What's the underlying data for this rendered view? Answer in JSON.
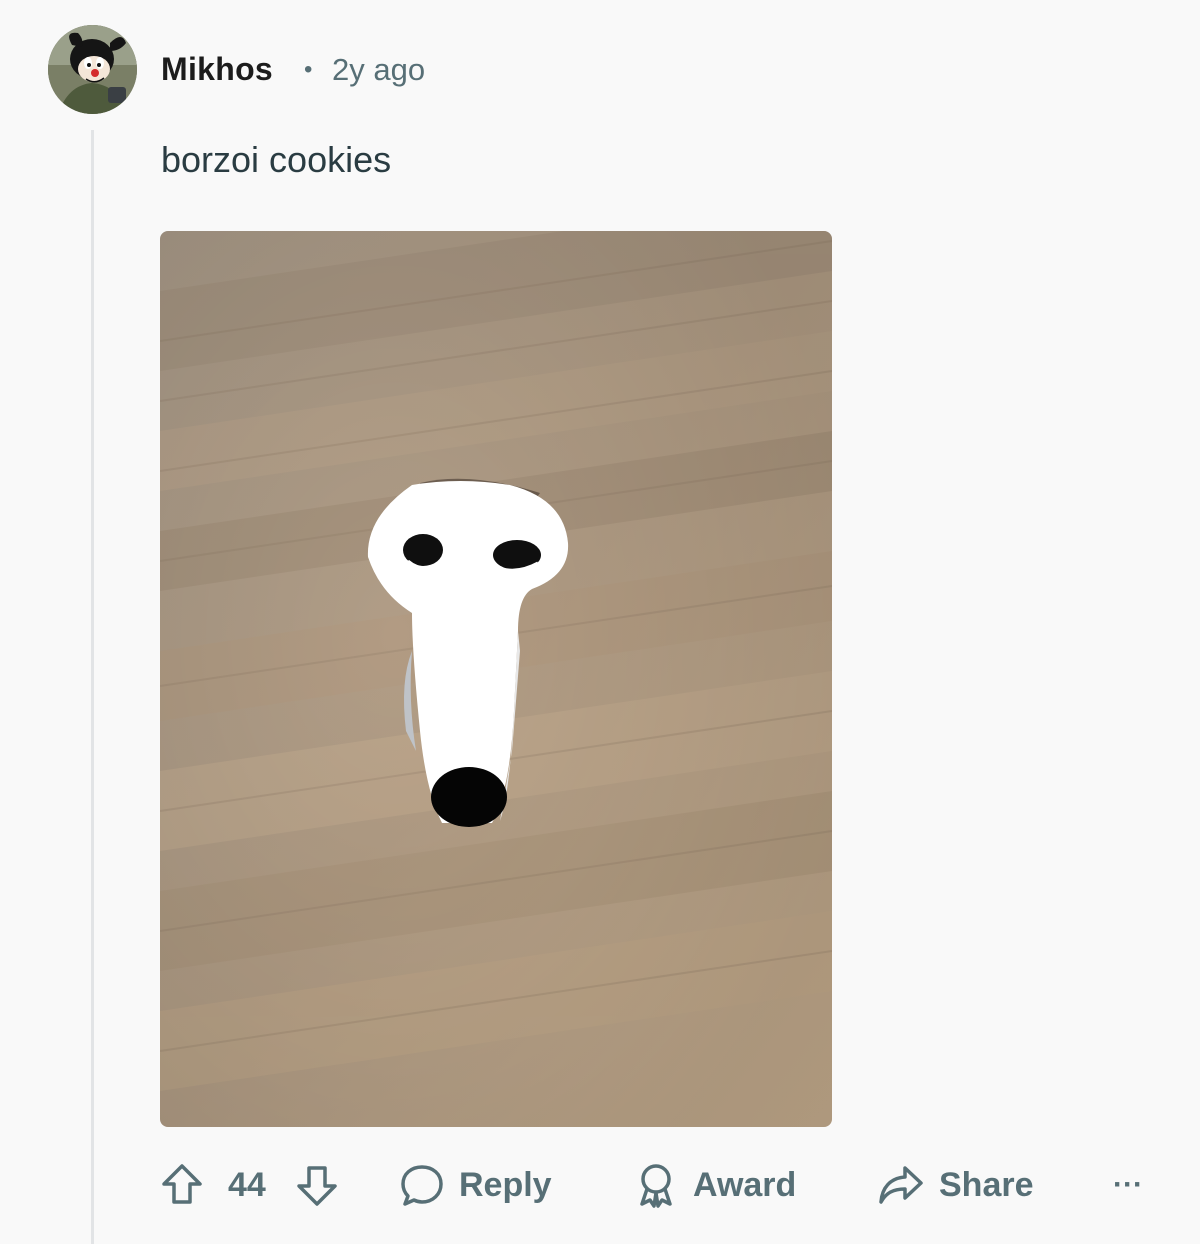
{
  "comment": {
    "author": "Mikhos",
    "separator": "•",
    "time": "2y ago",
    "body": "borzoi cookies",
    "image_alt": "borzoi cookie with drawn face on wooden table"
  },
  "actions": {
    "upvote_icon": "arrow-up-icon",
    "score": "44",
    "downvote_icon": "arrow-down-icon",
    "reply_label": "Reply",
    "award_label": "Award",
    "share_label": "Share",
    "more_label": "···"
  },
  "colors": {
    "background": "#f9f9f9",
    "meta_text": "#576f76",
    "thread_line": "#e2e4e6"
  }
}
